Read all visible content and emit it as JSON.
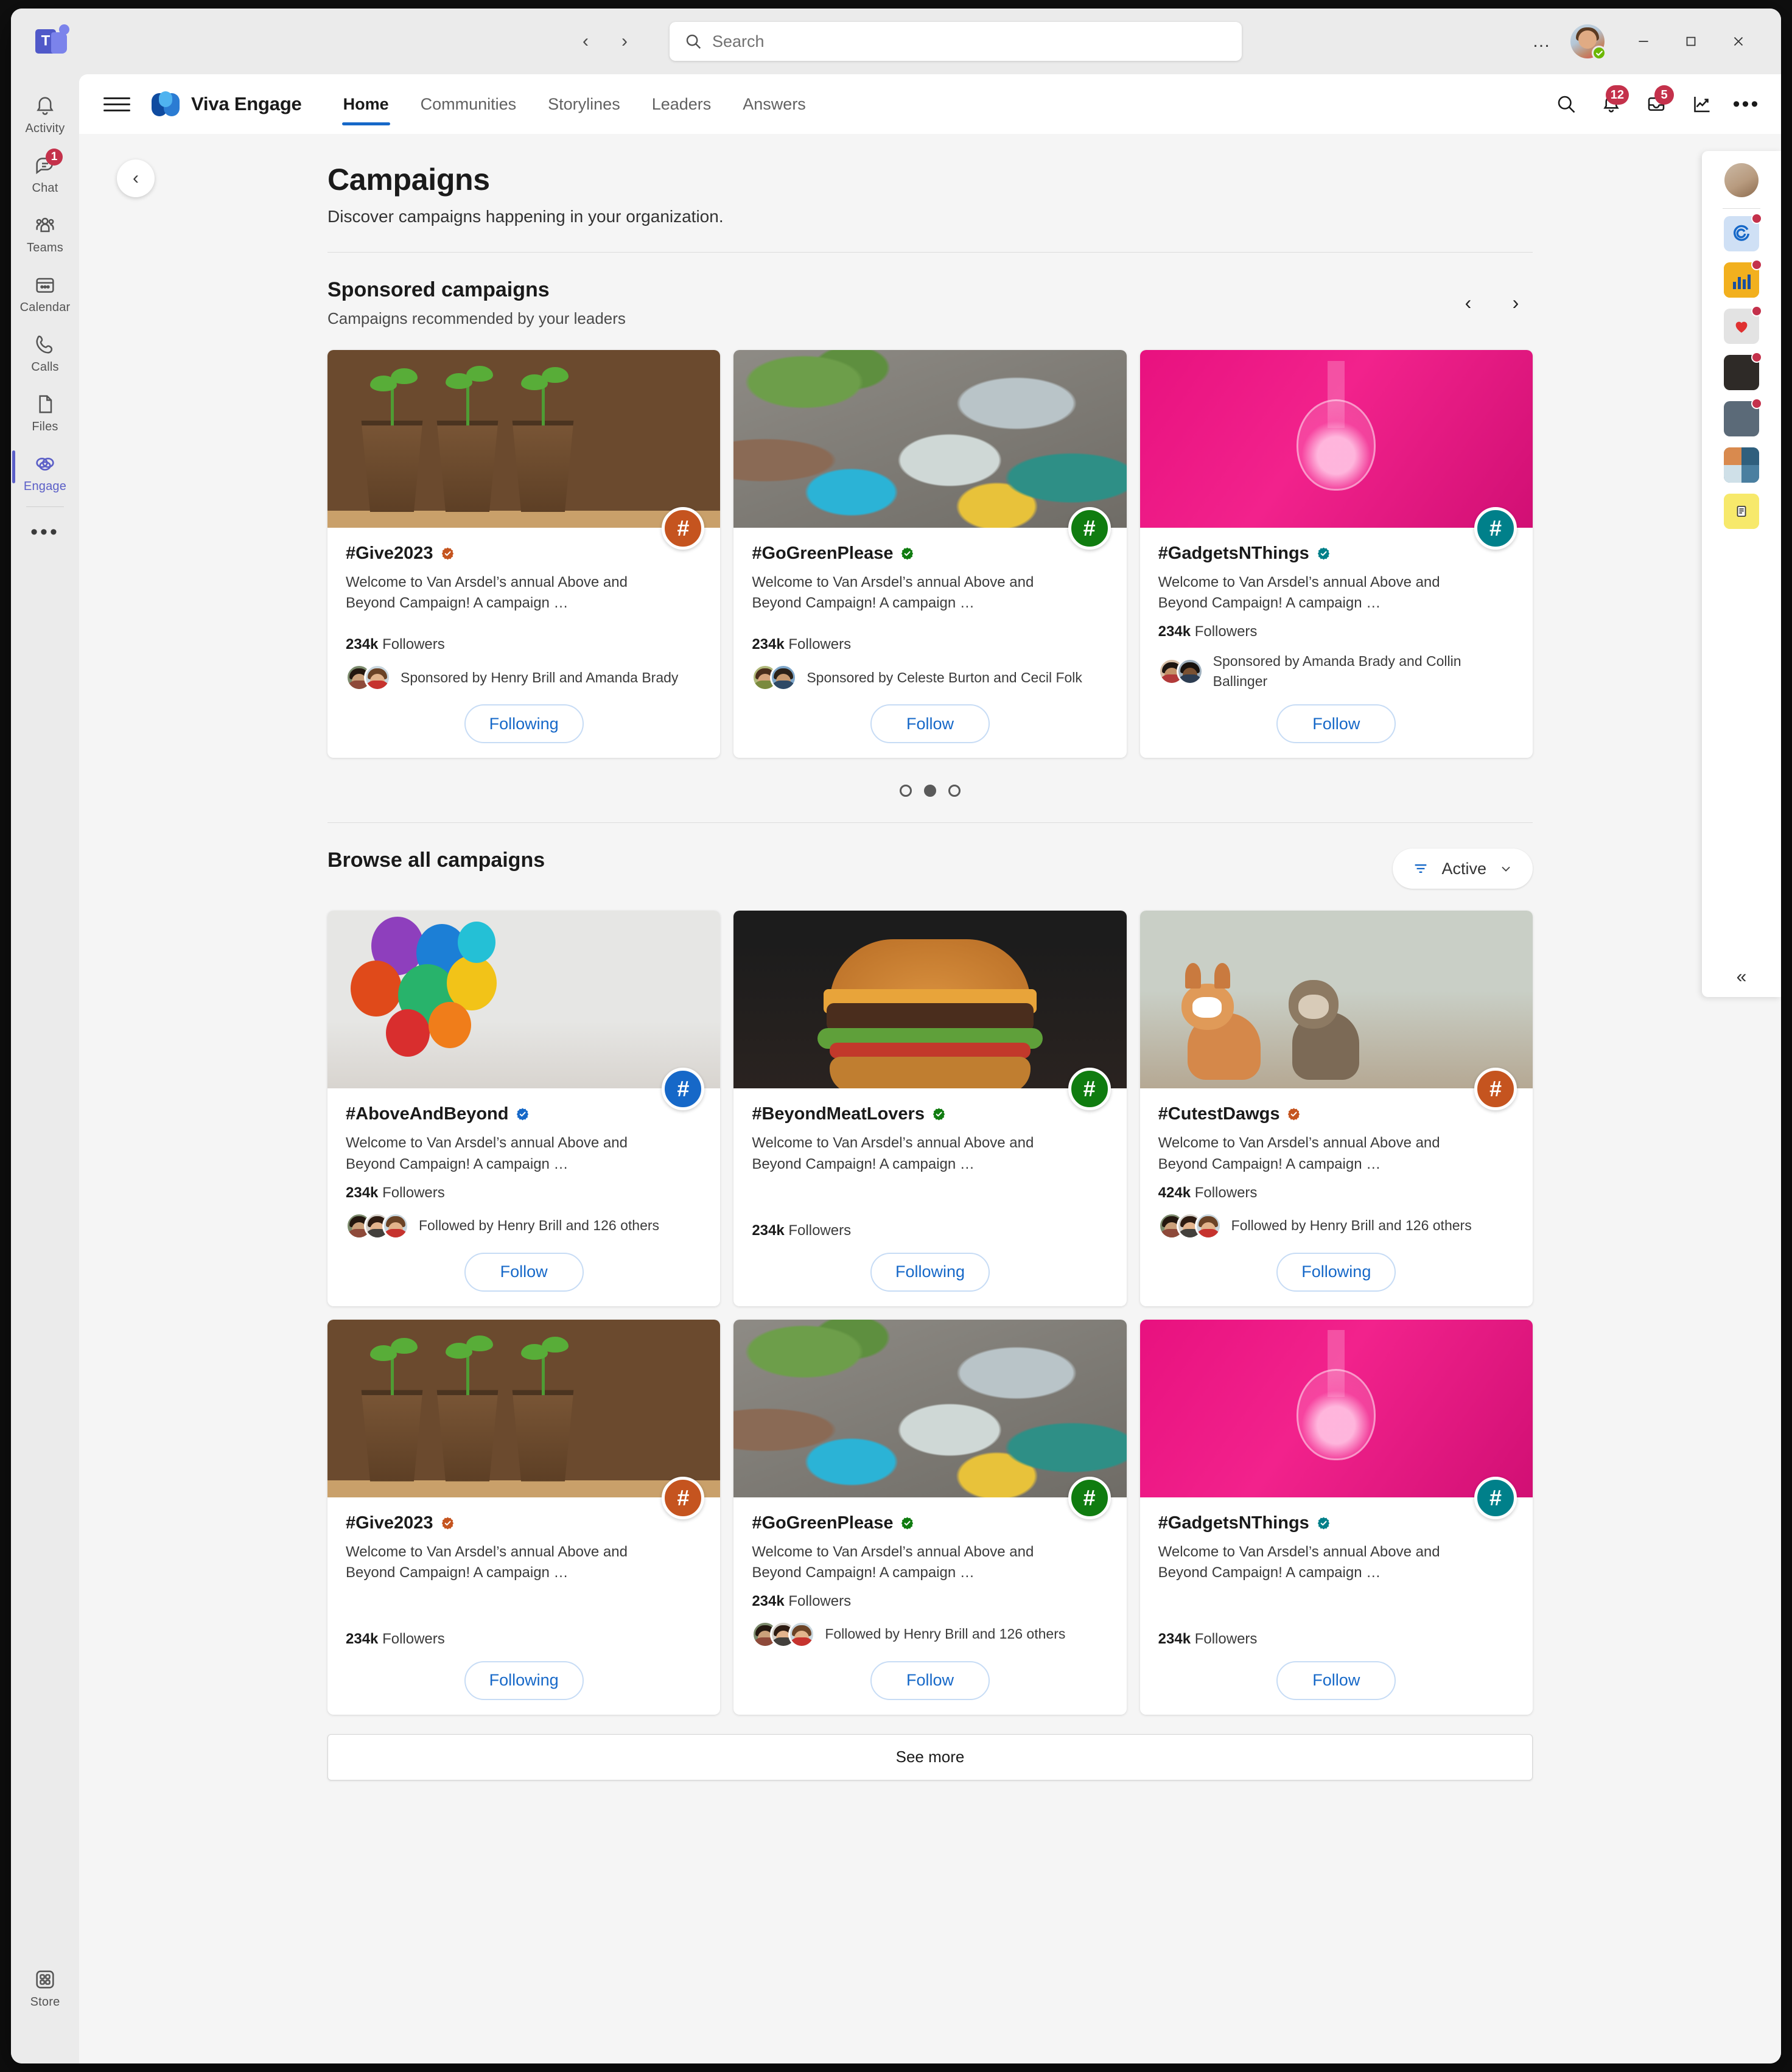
{
  "titlebar": {
    "app_logo": "teams-logo",
    "back_icon": "chevron-left-icon",
    "forward_icon": "chevron-right-icon",
    "search_placeholder": "Search",
    "search_value": "",
    "overflow_label": "…",
    "account_name": "Account manager",
    "minimize_label": "Minimize",
    "maximize_label": "Maximize",
    "close_label": "Close"
  },
  "rail": {
    "items": [
      {
        "label": "Activity",
        "icon": "bell-icon",
        "badge": ""
      },
      {
        "label": "Chat",
        "icon": "chat-icon",
        "badge": "1"
      },
      {
        "label": "Teams",
        "icon": "teams-people-icon",
        "badge": ""
      },
      {
        "label": "Calendar",
        "icon": "calendar-icon",
        "badge": ""
      },
      {
        "label": "Calls",
        "icon": "phone-icon",
        "badge": ""
      },
      {
        "label": "Files",
        "icon": "file-icon",
        "badge": ""
      },
      {
        "label": "Engage",
        "icon": "viva-engage-icon",
        "badge": ""
      }
    ],
    "more_label": "•••",
    "store": {
      "label": "Store",
      "icon": "store-grid-icon"
    }
  },
  "engage_header": {
    "menu_icon": "hamburger-icon",
    "brand": "Viva Engage",
    "tabs": [
      {
        "label": "Home",
        "active": true
      },
      {
        "label": "Communities",
        "active": false
      },
      {
        "label": "Storylines",
        "active": false
      },
      {
        "label": "Leaders",
        "active": false
      },
      {
        "label": "Answers",
        "active": false
      }
    ],
    "actions": [
      {
        "name": "search-icon",
        "badge": ""
      },
      {
        "name": "bell-icon",
        "badge": "12"
      },
      {
        "name": "inbox-icon",
        "badge": "5"
      },
      {
        "name": "analytics-icon",
        "badge": ""
      },
      {
        "name": "more-icon",
        "badge": ""
      }
    ]
  },
  "page": {
    "back_icon": "chevron-left-icon",
    "title": "Campaigns",
    "subtitle": "Discover campaigns happening in your organization."
  },
  "sponsored": {
    "title": "Sponsored campaigns",
    "subtitle": "Campaigns recommended by your leaders",
    "prev_icon": "chevron-left-icon",
    "next_icon": "chevron-right-icon",
    "pagination": {
      "count": 3,
      "active_index": 1
    },
    "cards": [
      {
        "title": "#Give2023",
        "verified": true,
        "badge_color": "#c5541f",
        "description": "Welcome to Van Arsdel’s annual Above and Beyond Campaign! A campaign …",
        "followers_count": "234k",
        "followers_label": "Followers",
        "attribution": "Sponsored by Henry Brill and Amanda Brady",
        "faces": 2,
        "action": "Following",
        "image": "seedlings-in-pots"
      },
      {
        "title": "#GoGreenPlease",
        "verified": true,
        "badge_color": "#107c10",
        "description": "Welcome to Van Arsdel’s annual Above and Beyond Campaign! A campaign …",
        "followers_count": "234k",
        "followers_label": "Followers",
        "attribution": "Sponsored by Celeste Burton and Cecil Folk",
        "faces": 2,
        "action": "Follow",
        "image": "plastic-bottle-litter"
      },
      {
        "title": "#GadgetsNThings",
        "verified": true,
        "badge_color": "#00808a",
        "description": "Welcome to Van Arsdel’s annual Above and Beyond Campaign! A campaign …",
        "followers_count": "234k",
        "followers_label": "Followers",
        "attribution": "Sponsored by Amanda Brady and Collin Ballinger",
        "faces": 2,
        "action": "Follow",
        "image": "pink-lightbulb"
      }
    ]
  },
  "browse": {
    "title": "Browse all campaigns",
    "filter": {
      "icon": "filter-icon",
      "label": "Active",
      "chevron": "chevron-down-icon"
    },
    "see_more": "See more",
    "cards": [
      {
        "title": "#AboveAndBeyond",
        "verified": true,
        "badge_color": "#1668c8",
        "description": "Welcome to Van Arsdel’s annual Above and Beyond Campaign! A campaign …",
        "followers_count": "234k",
        "followers_label": "Followers",
        "attribution": "Followed by Henry Brill and 126 others",
        "faces": 3,
        "action": "Follow",
        "image": "colorful-balloons"
      },
      {
        "title": "#BeyondMeatLovers",
        "verified": true,
        "badge_color": "#107c10",
        "description": "Welcome to Van Arsdel’s annual Above and Beyond Campaign! A campaign …",
        "followers_count": "234k",
        "followers_label": "Followers",
        "attribution": "",
        "faces": 0,
        "action": "Following",
        "image": "cheeseburger"
      },
      {
        "title": "#CutestDawgs",
        "verified": true,
        "badge_color": "#c5541f",
        "description": "Welcome to Van Arsdel’s annual Above and Beyond Campaign! A campaign …",
        "followers_count": "424k",
        "followers_label": "Followers",
        "attribution": "Followed by Henry Brill and 126 others",
        "faces": 3,
        "action": "Following",
        "image": "two-dogs-running"
      },
      {
        "title": "#Give2023",
        "verified": true,
        "badge_color": "#c5541f",
        "description": "Welcome to Van Arsdel’s annual Above and Beyond Campaign! A campaign …",
        "followers_count": "234k",
        "followers_label": "Followers",
        "attribution": "",
        "faces": 0,
        "action": "Following",
        "image": "seedlings-in-pots"
      },
      {
        "title": "#GoGreenPlease",
        "verified": true,
        "badge_color": "#107c10",
        "description": "Welcome to Van Arsdel’s annual Above and Beyond Campaign! A campaign …",
        "followers_count": "234k",
        "followers_label": "Followers",
        "attribution": "Followed by Henry Brill and 126 others",
        "faces": 3,
        "action": "Follow",
        "image": "plastic-bottle-litter"
      },
      {
        "title": "#GadgetsNThings",
        "verified": true,
        "badge_color": "#00808a",
        "description": "Welcome to Van Arsdel’s annual Above and Beyond Campaign! A campaign …",
        "followers_count": "234k",
        "followers_label": "Followers",
        "attribution": "",
        "faces": 0,
        "action": "Follow",
        "image": "pink-lightbulb"
      }
    ]
  },
  "right_rail": {
    "avatar_name": "user-avatar",
    "apps": [
      {
        "name": "viva-connections-icon",
        "badge": true,
        "bg": "#cfe0f5"
      },
      {
        "name": "viva-insights-icon",
        "badge": true,
        "bg": "#f2b01e"
      },
      {
        "name": "praise-heart-icon",
        "badge": true,
        "bg": "#e3e3e3"
      },
      {
        "name": "person-photo-icon",
        "badge": true,
        "bg": "#2e2a27"
      },
      {
        "name": "meeting-photo-icon",
        "badge": true,
        "bg": "#5b6a78"
      },
      {
        "name": "people-grid-icon",
        "badge": false,
        "bg": "#3d6e8e"
      },
      {
        "name": "notes-icon",
        "badge": false,
        "bg": "#f7e96b"
      }
    ],
    "collapse_icon": "chevrons-left-icon"
  },
  "colors": {
    "accent": "#1668c8",
    "badge_red": "#c4314b",
    "engage_purple": "#5b5fc7",
    "surface": "#f5f5f5"
  }
}
